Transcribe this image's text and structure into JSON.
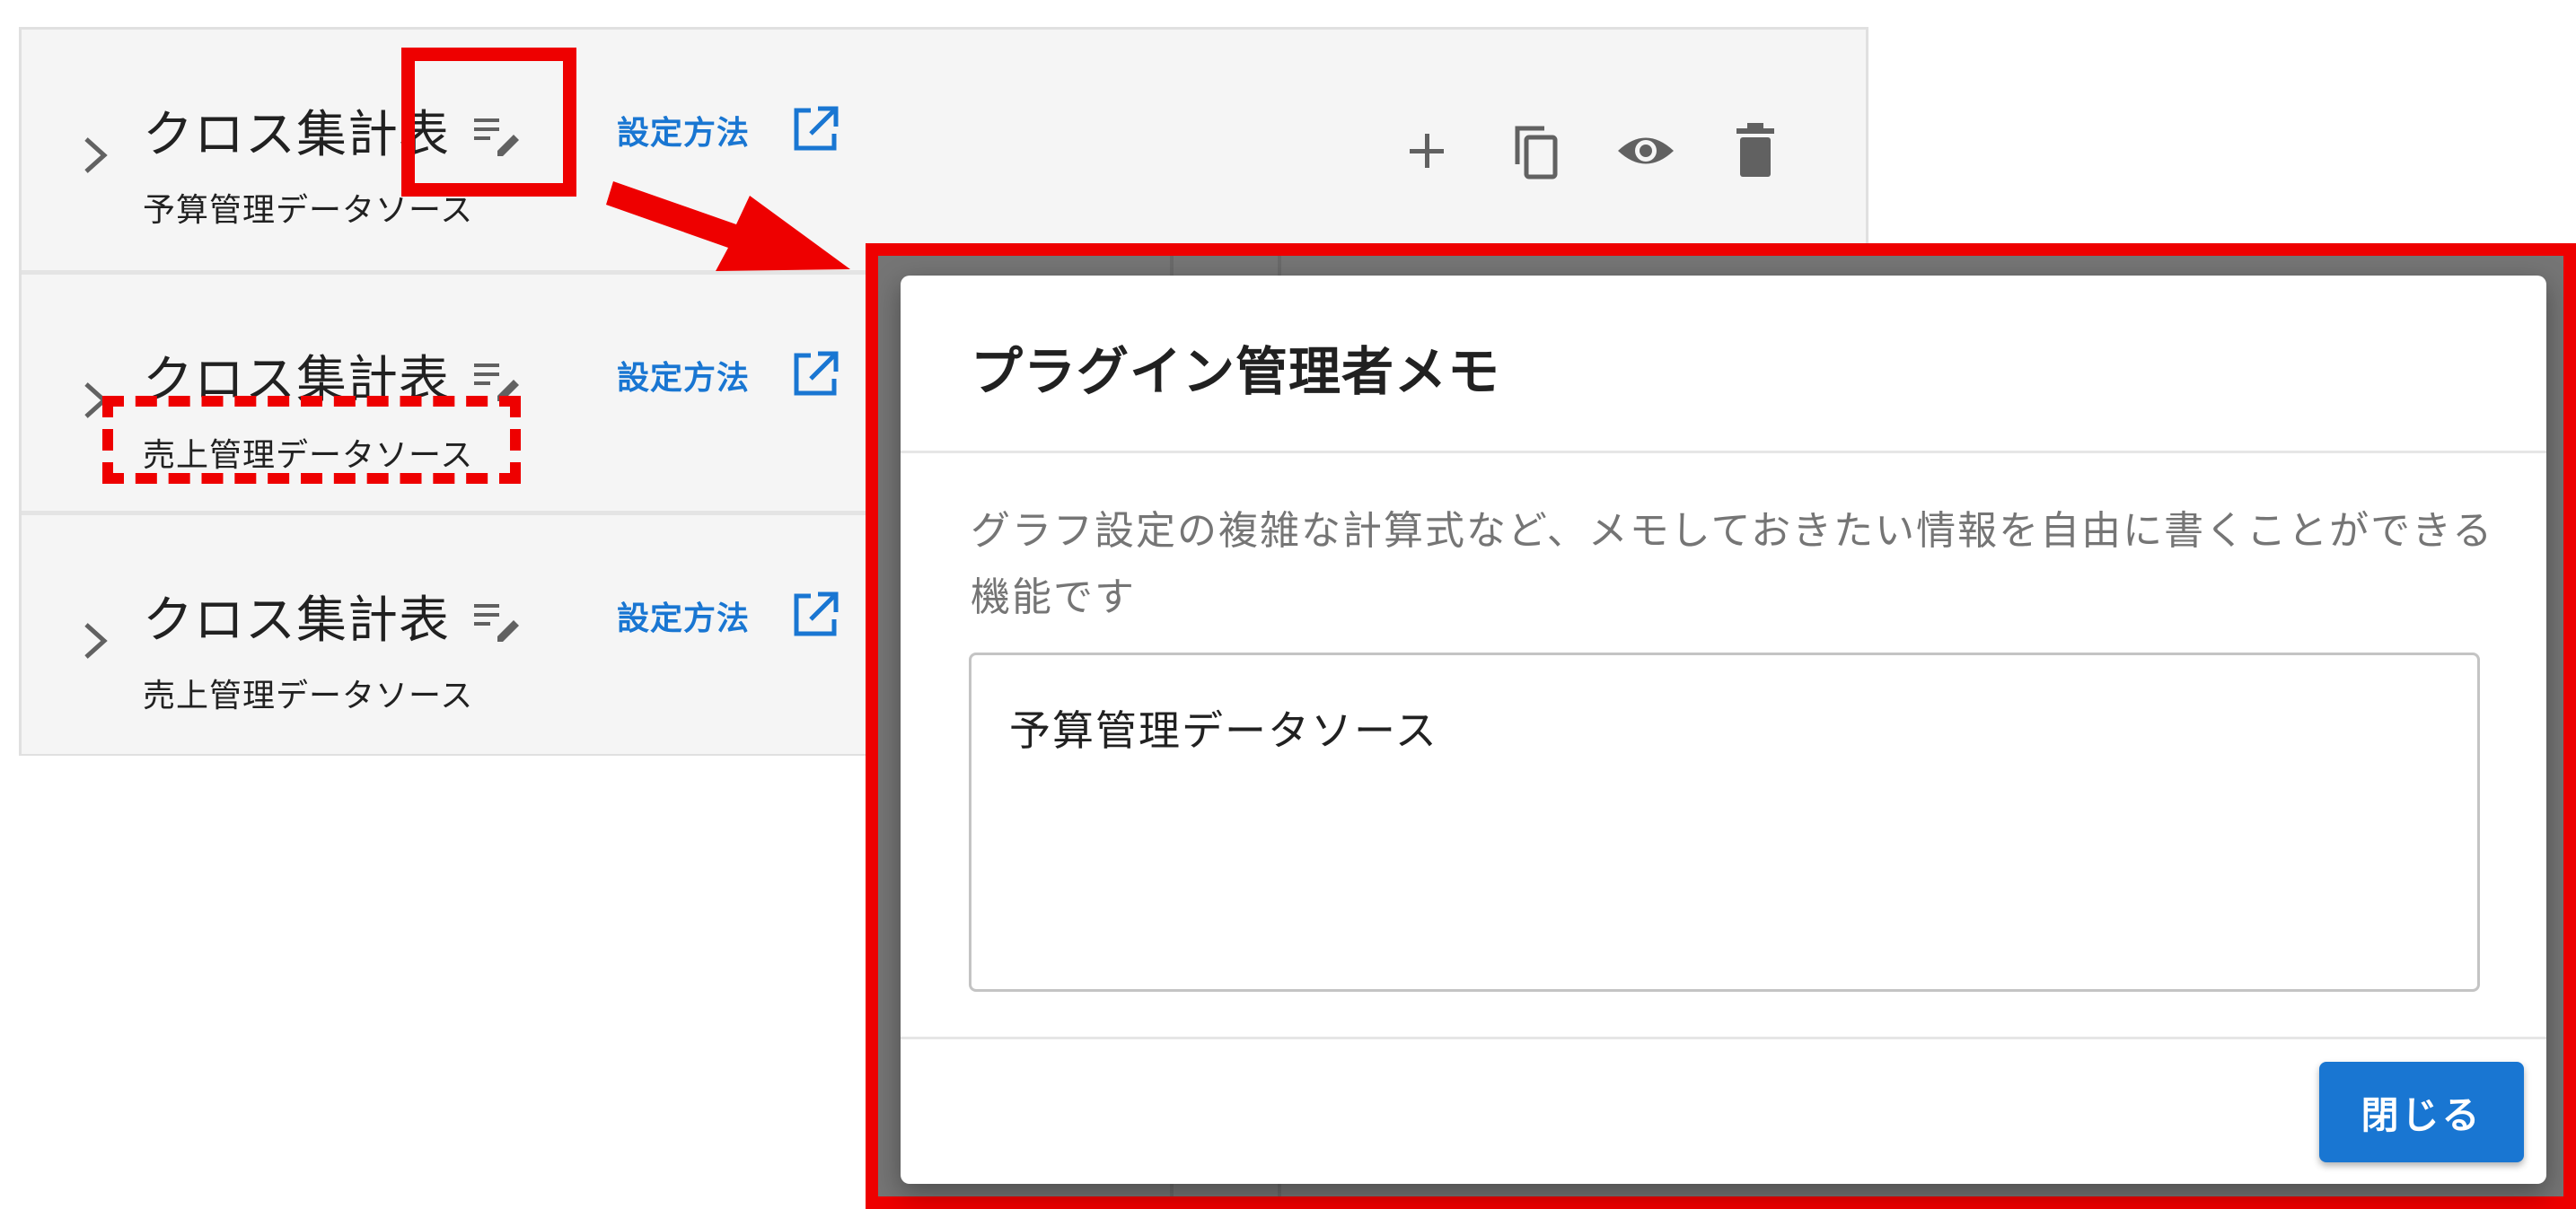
{
  "plugin_list": {
    "rows": [
      {
        "title": "クロス集計表",
        "subtitle": "予算管理データソース",
        "howto_label": "設定方法"
      },
      {
        "title": "クロス集計表",
        "subtitle": "売上管理データソース",
        "howto_label": "設定方法"
      },
      {
        "title": "クロス集計表",
        "subtitle": "売上管理データソース",
        "howto_label": "設定方法"
      }
    ],
    "actions": {
      "add_icon": "plus-icon",
      "copy_icon": "copy-icon",
      "preview_icon": "eye-icon",
      "delete_icon": "trash-icon"
    }
  },
  "dialog": {
    "title": "プラグイン管理者メモ",
    "description": "グラフ設定の複雑な計算式など、メモしておきたい情報を自由に書くことができる機能です",
    "memo_value": "予算管理データソース",
    "close_label": "閉じる"
  },
  "colors": {
    "accent": "#1976d2",
    "annotation_red": "#ee0000",
    "icon_gray": "#616161",
    "backdrop": "#757575"
  }
}
